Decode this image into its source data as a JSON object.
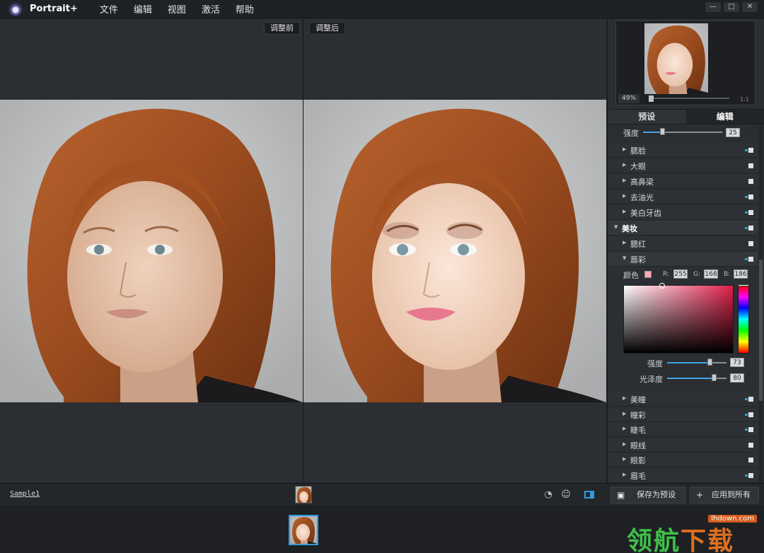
{
  "titlebar": {
    "app_name": "Portrait+",
    "menu": [
      "文件",
      "编辑",
      "视图",
      "激活",
      "帮助"
    ],
    "minimize": "—",
    "maximize": "□",
    "close": "✕"
  },
  "views": {
    "before_label": "调整前",
    "after_label": "调整后"
  },
  "navigator": {
    "zoom": "49%",
    "ratio": "1:1"
  },
  "tabs": [
    {
      "label": "预设",
      "active": false
    },
    {
      "label": "编辑",
      "active": true
    }
  ],
  "strength_top": {
    "label": "强度",
    "value": "25",
    "level": 0.25
  },
  "items_top": [
    {
      "label": "腮脸",
      "on": true
    },
    {
      "label": "大眼",
      "on": false
    },
    {
      "label": "高鼻梁",
      "on": false
    },
    {
      "label": "去油光",
      "on": true
    },
    {
      "label": "美白牙齿",
      "on": true
    }
  ],
  "section_makeup": {
    "label": "美妆",
    "on": true
  },
  "items_makeup": [
    {
      "label": "腮红",
      "on": false
    },
    {
      "label": "唇彩",
      "on": true,
      "expanded": true
    }
  ],
  "lip_editor": {
    "color_label": "颜色",
    "swatch_color": "#ffa8ba",
    "r_label": "R:",
    "r": "255",
    "g_label": "G:",
    "g": "168",
    "b_label": "B:",
    "b": "186",
    "strength_label": "强度",
    "strength_value": "73",
    "strength_level": 0.73,
    "gloss_label": "光泽度",
    "gloss_value": "80",
    "gloss_level": 0.8
  },
  "items_bottom": [
    {
      "label": "美瞳",
      "on": true
    },
    {
      "label": "瞳彩",
      "on": true
    },
    {
      "label": "睫毛",
      "on": true
    },
    {
      "label": "眼线",
      "on": false
    },
    {
      "label": "眼影",
      "on": false
    },
    {
      "label": "眉毛",
      "on": true
    }
  ],
  "bottom_bar": {
    "sample_name": "Sample1",
    "save_preset": "保存为预设",
    "apply_all": "应用到所有",
    "save_icon": "floppy-icon",
    "plus_icon": "+"
  },
  "watermark": {
    "site": "lhdown.com",
    "text_a": "领航",
    "text_b": "下载"
  },
  "colors": {
    "accent": "#2f9be0",
    "background": "#26292d",
    "panel": "#2a2d31"
  }
}
